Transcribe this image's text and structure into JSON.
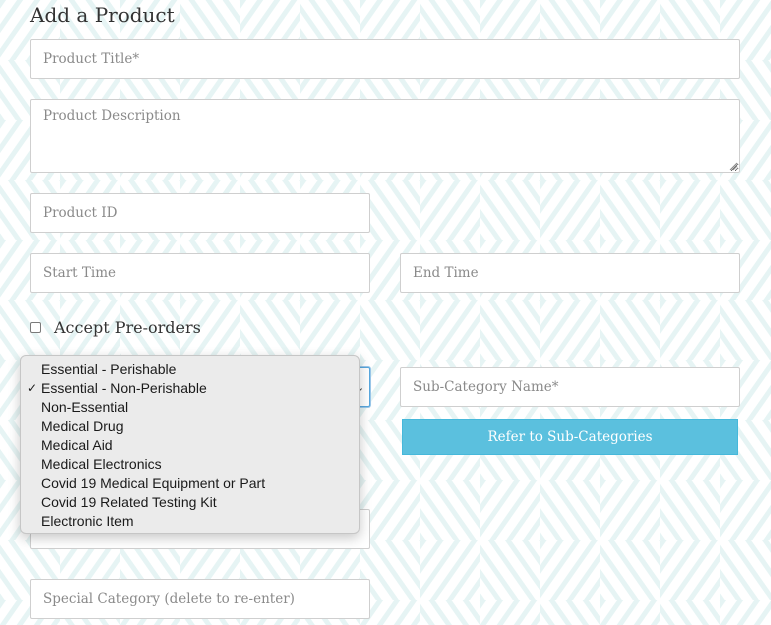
{
  "page": {
    "title": "Add a Product"
  },
  "form": {
    "product_title_placeholder": "Product Title*",
    "product_description_placeholder": "Product Description",
    "product_id_placeholder": "Product ID",
    "start_time_placeholder": "Start Time",
    "end_time_placeholder": "End Time",
    "accept_preorders_label": "Accept Pre-orders",
    "accept_preorders_checked": false,
    "subcategory_name_placeholder": "Sub-Category Name*",
    "refer_button_label": "Refer to Sub-Categories",
    "special_category_placeholder": "Special Category (delete to re-enter)"
  },
  "category_dropdown": {
    "selected_index": 1,
    "options": [
      "Essential - Perishable",
      "Essential - Non-Perishable",
      "Non-Essential",
      "Medical Drug",
      "Medical Aid",
      "Medical Electronics",
      "Covid 19 Medical Equipment or Part",
      "Covid 19 Related Testing Kit",
      "Electronic Item"
    ]
  },
  "colors": {
    "accent_button": "#5bc0de",
    "pattern": "#e4f3f3",
    "focus_border": "#59a8de"
  },
  "icons": {
    "selected_marker": "checkmark-icon",
    "select_arrow": "chevron-down-icon",
    "resize": "resize-grip-icon"
  }
}
